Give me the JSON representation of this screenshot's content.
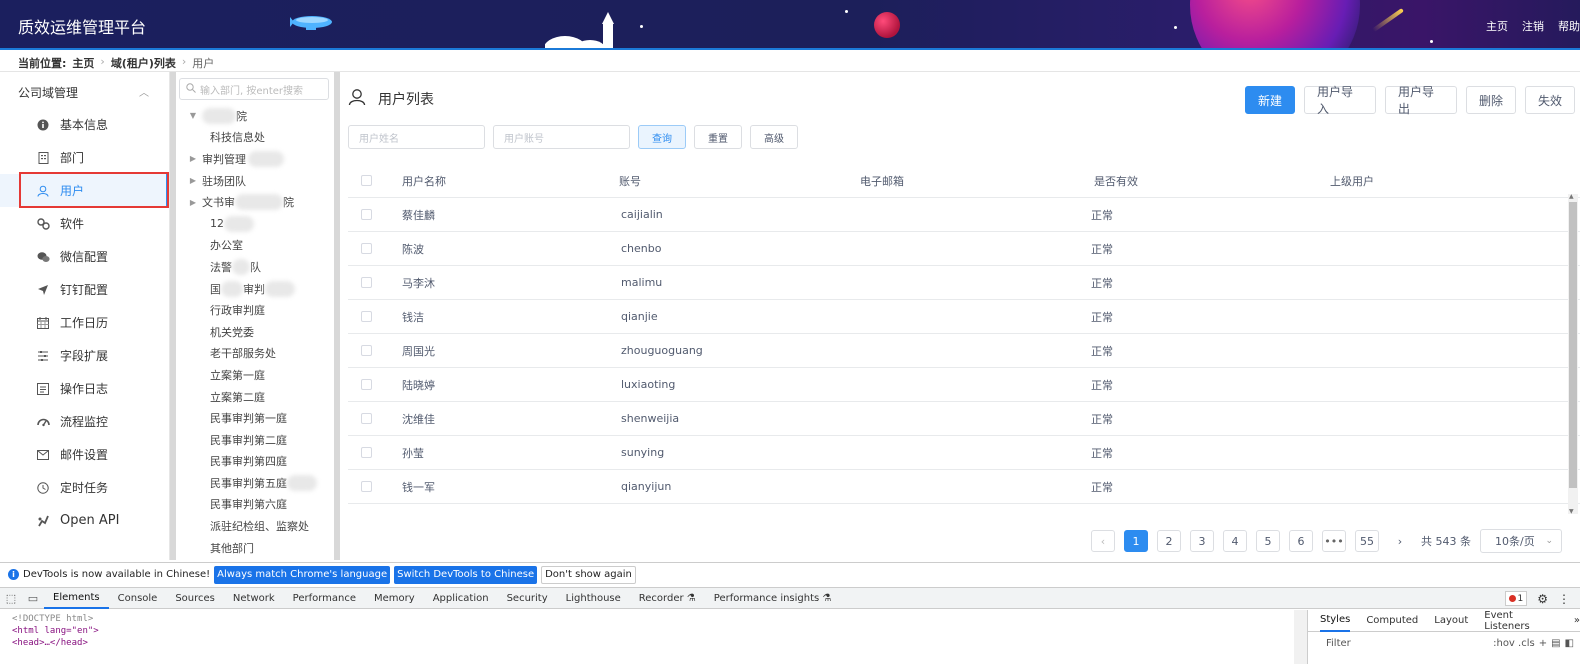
{
  "app": {
    "title": "质效运维管理平台",
    "nav": [
      "主页",
      "注销",
      "帮助"
    ]
  },
  "breadcrumb": {
    "prefix": "当前位置:",
    "items": [
      "主页",
      "域(租户)列表",
      "用户"
    ]
  },
  "leftmenu": {
    "group": "公司域管理",
    "items": [
      {
        "label": "基本信息",
        "icon": "info-icon"
      },
      {
        "label": "部门",
        "icon": "building-icon"
      },
      {
        "label": "用户",
        "icon": "user-icon",
        "active": true
      },
      {
        "label": "软件",
        "icon": "software-icon"
      },
      {
        "label": "微信配置",
        "icon": "wechat-icon"
      },
      {
        "label": "钉钉配置",
        "icon": "dingtalk-icon"
      },
      {
        "label": "工作日历",
        "icon": "calendar-icon"
      },
      {
        "label": "字段扩展",
        "icon": "fields-icon"
      },
      {
        "label": "操作日志",
        "icon": "log-icon"
      },
      {
        "label": "流程监控",
        "icon": "monitor-icon"
      },
      {
        "label": "邮件设置",
        "icon": "mail-icon"
      },
      {
        "label": "定时任务",
        "icon": "clock-icon"
      },
      {
        "label": "Open API",
        "icon": "api-icon"
      }
    ]
  },
  "tree": {
    "search_placeholder": "输入部门, 按enter搜索",
    "nodes": [
      {
        "label": "院",
        "arrow": "down",
        "redacted": true
      },
      {
        "label": "科技信息处"
      },
      {
        "label": "审判管理",
        "arrow": "right"
      },
      {
        "label": "驻场团队",
        "arrow": "right"
      },
      {
        "label": "文书审",
        "arrow": "right",
        "suffix": "院"
      },
      {
        "label": "12"
      },
      {
        "label": "办公室"
      },
      {
        "label": "法警",
        "suffix": "队"
      },
      {
        "label": "国",
        "suffix": "审判"
      },
      {
        "label": "行政审判庭"
      },
      {
        "label": "机关党委"
      },
      {
        "label": "老干部服务处"
      },
      {
        "label": "立案第一庭"
      },
      {
        "label": "立案第二庭"
      },
      {
        "label": "民事审判第一庭"
      },
      {
        "label": "民事审判第二庭"
      },
      {
        "label": "民事审判第四庭"
      },
      {
        "label": "民事审判第五庭"
      },
      {
        "label": "民事审判第六庭"
      },
      {
        "label": "派驻纪检组、监察处"
      },
      {
        "label": "其他部门"
      }
    ]
  },
  "main": {
    "title": "用户列表",
    "toolbar": [
      "新建",
      "用户导入",
      "用户导出",
      "删除",
      "失效"
    ],
    "filters": {
      "name_placeholder": "用户姓名",
      "account_placeholder": "用户账号",
      "query": "查询",
      "reset": "重置",
      "advanced": "高级"
    },
    "columns": [
      "用户名称",
      "账号",
      "电子邮箱",
      "是否有效",
      "上级用户"
    ],
    "rows": [
      {
        "name": "蔡佳麟",
        "account": "caijialin",
        "email": "",
        "valid": "正常",
        "superior": ""
      },
      {
        "name": "陈波",
        "account": "chenbo",
        "email": "",
        "valid": "正常",
        "superior": ""
      },
      {
        "name": "马李沐",
        "account": "malimu",
        "email": "",
        "valid": "正常",
        "superior": ""
      },
      {
        "name": "钱洁",
        "account": "qianjie",
        "email": "",
        "valid": "正常",
        "superior": ""
      },
      {
        "name": "周国光",
        "account": "zhouguoguang",
        "email": "",
        "valid": "正常",
        "superior": ""
      },
      {
        "name": "陆晓婷",
        "account": "luxiaoting",
        "email": "",
        "valid": "正常",
        "superior": ""
      },
      {
        "name": "沈维佳",
        "account": "shenweijia",
        "email": "",
        "valid": "正常",
        "superior": ""
      },
      {
        "name": "孙莹",
        "account": "sunying",
        "email": "",
        "valid": "正常",
        "superior": ""
      },
      {
        "name": "钱一军",
        "account": "qianyijun",
        "email": "",
        "valid": "正常",
        "superior": ""
      }
    ],
    "pager": {
      "pages": [
        "1",
        "2",
        "3",
        "4",
        "5",
        "6",
        "•••",
        "55"
      ],
      "current": "1",
      "total": "共 543 条",
      "page_size": "10条/页"
    }
  },
  "devtools": {
    "banner": {
      "message": "DevTools is now available in Chinese!",
      "match": "Always match Chrome's language",
      "switch": "Switch DevTools to Chinese",
      "dismiss": "Don't show again"
    },
    "tabs": [
      "Elements",
      "Console",
      "Sources",
      "Network",
      "Performance",
      "Memory",
      "Application",
      "Security",
      "Lighthouse",
      "Recorder",
      "Performance insights"
    ],
    "error_count": "1",
    "code_lines": [
      "<!DOCTYPE html>",
      "<html lang=\"en\">",
      "<head>…</head>"
    ],
    "styles_tabs": [
      "Styles",
      "Computed",
      "Layout",
      "Event Listeners"
    ],
    "filter_label": "Filter",
    "filter_tools": ":hov .cls"
  },
  "colors": {
    "accent": "#2d8cf0",
    "header_bg": "#1b1f5e",
    "highlight": "#e53935",
    "devtools_blue": "#1a73e8"
  }
}
